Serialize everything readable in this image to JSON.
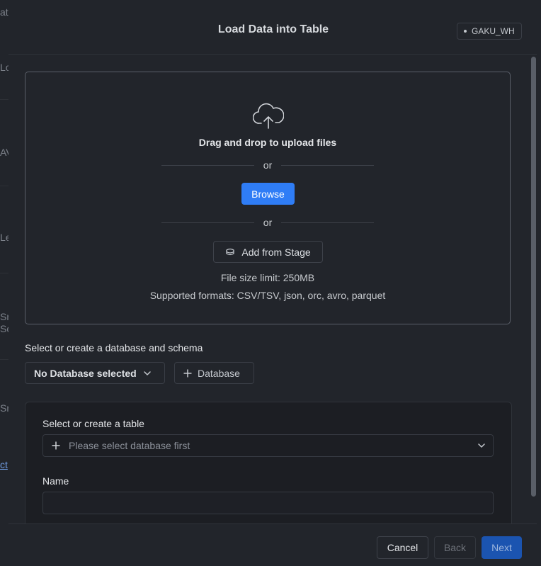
{
  "background": {
    "fragments": [
      "at",
      "Lo",
      "AV",
      "Le",
      "Sn",
      "Sc",
      "Sn",
      "ct"
    ]
  },
  "modal": {
    "title": "Load Data into Table",
    "warehouse": "GAKU_WH"
  },
  "upload": {
    "icon": "cloud-upload-icon",
    "heading": "Drag and drop to upload files",
    "or_1": "or",
    "browse_label": "Browse",
    "or_2": "or",
    "stage_icon": "stage-icon",
    "stage_label": "Add from Stage",
    "size_limit": "File size limit: 250MB",
    "formats": "Supported formats: CSV/TSV, json, orc, avro, parquet"
  },
  "database": {
    "section_label": "Select or create a database and schema",
    "selected": "No Database selected",
    "add_label": "Database"
  },
  "table": {
    "label": "Select or create a table",
    "placeholder": "Please select database first",
    "name_label": "Name",
    "name_value": ""
  },
  "footer": {
    "cancel": "Cancel",
    "back": "Back",
    "next": "Next"
  },
  "colors": {
    "primary": "#2f7df6",
    "next_disabled": "#1b54b0",
    "modal_bg": "#22252b"
  }
}
